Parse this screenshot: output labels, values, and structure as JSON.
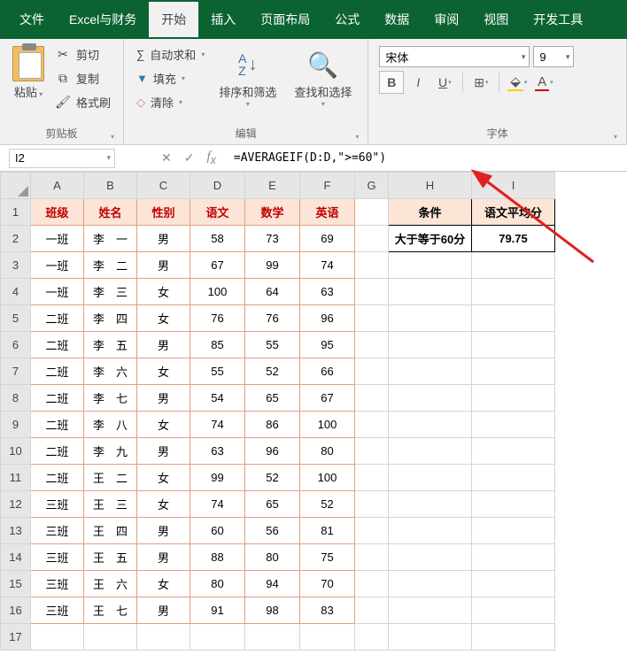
{
  "tabs": {
    "file": "文件",
    "custom": "Excel与财务",
    "home": "开始",
    "insert": "插入",
    "layout": "页面布局",
    "formula": "公式",
    "data": "数据",
    "review": "审阅",
    "view": "视图",
    "dev": "开发工具"
  },
  "ribbon": {
    "paste": "粘贴",
    "cut": "剪切",
    "copy": "复制",
    "formatpaint": "格式刷",
    "clipboard_label": "剪贴板",
    "autosum": "自动求和",
    "fill": "填充",
    "clear": "清除",
    "sort": "排序和筛选",
    "find": "查找和选择",
    "editing_label": "编辑",
    "font_name": "宋体",
    "font_size": "9",
    "font_label": "字体"
  },
  "namebox": "I2",
  "formula": "=AVERAGEIF(D:D,\">=60\")",
  "columns": [
    "A",
    "B",
    "C",
    "D",
    "E",
    "F",
    "G",
    "H",
    "I"
  ],
  "headers": {
    "class": "班级",
    "name": "姓名",
    "gender": "性别",
    "chinese": "语文",
    "math": "数学",
    "english": "英语",
    "cond": "条件",
    "avg": "语文平均分"
  },
  "cond_value": "大于等于60分",
  "avg_value": "79.75",
  "rows": [
    {
      "class": "一班",
      "name": "李　一",
      "gender": "男",
      "c": "58",
      "m": "73",
      "e": "69"
    },
    {
      "class": "一班",
      "name": "李　二",
      "gender": "男",
      "c": "67",
      "m": "99",
      "e": "74"
    },
    {
      "class": "一班",
      "name": "李　三",
      "gender": "女",
      "c": "100",
      "m": "64",
      "e": "63"
    },
    {
      "class": "二班",
      "name": "李　四",
      "gender": "女",
      "c": "76",
      "m": "76",
      "e": "96"
    },
    {
      "class": "二班",
      "name": "李　五",
      "gender": "男",
      "c": "85",
      "m": "55",
      "e": "95"
    },
    {
      "class": "二班",
      "name": "李　六",
      "gender": "女",
      "c": "55",
      "m": "52",
      "e": "66"
    },
    {
      "class": "二班",
      "name": "李　七",
      "gender": "男",
      "c": "54",
      "m": "65",
      "e": "67"
    },
    {
      "class": "二班",
      "name": "李　八",
      "gender": "女",
      "c": "74",
      "m": "86",
      "e": "100"
    },
    {
      "class": "二班",
      "name": "李　九",
      "gender": "男",
      "c": "63",
      "m": "96",
      "e": "80"
    },
    {
      "class": "二班",
      "name": "王　二",
      "gender": "女",
      "c": "99",
      "m": "52",
      "e": "100"
    },
    {
      "class": "三班",
      "name": "王　三",
      "gender": "女",
      "c": "74",
      "m": "65",
      "e": "52"
    },
    {
      "class": "三班",
      "name": "王　四",
      "gender": "男",
      "c": "60",
      "m": "56",
      "e": "81"
    },
    {
      "class": "三班",
      "name": "王　五",
      "gender": "男",
      "c": "88",
      "m": "80",
      "e": "75"
    },
    {
      "class": "三班",
      "name": "王　六",
      "gender": "女",
      "c": "80",
      "m": "94",
      "e": "70"
    },
    {
      "class": "三班",
      "name": "王　七",
      "gender": "男",
      "c": "91",
      "m": "98",
      "e": "83"
    }
  ]
}
